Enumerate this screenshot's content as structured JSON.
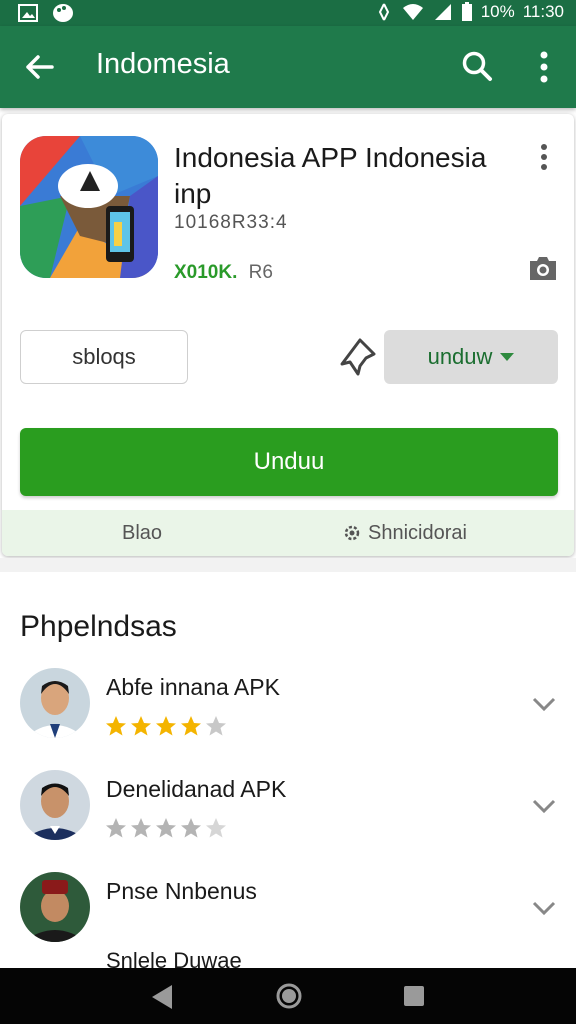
{
  "status_bar": {
    "battery": "10%",
    "time": "11:30"
  },
  "app_bar": {
    "title": "Indomesia"
  },
  "app": {
    "title": "Indonesia APP Indonesia inp",
    "developer": "10168R33:4",
    "rating": "X010K.",
    "size": "R6"
  },
  "buttons": {
    "secondary": "sbloqs",
    "dropdown": "unduw",
    "install": "Unduu"
  },
  "footer": {
    "left": "Blao",
    "right": "Shnicidorai"
  },
  "section": {
    "title": "Phpelndsas"
  },
  "reviews": [
    {
      "name": "Abfe innana APK",
      "stars": 4,
      "star_color": "#f4b400"
    },
    {
      "name": "Denelidanad APK",
      "stars": 4,
      "star_color": "#b4b4b4"
    },
    {
      "name": "Pnse Nnbenus"
    }
  ],
  "partial_text": "Snlele Duwae",
  "colors": {
    "status_bar": "#1b6e44",
    "app_bar": "#1f7a4b",
    "install": "#2a9d1f",
    "rating": "#2a9a2a"
  },
  "icons": [
    "image-icon",
    "palette-icon",
    "wifi-icon",
    "signal-icon",
    "battery-icon",
    "back-arrow-icon",
    "search-icon",
    "more-vert-icon",
    "camera-icon",
    "pin-icon",
    "gear-icon",
    "chevron-down-icon",
    "nav-back-icon",
    "nav-home-icon",
    "nav-recent-icon"
  ]
}
